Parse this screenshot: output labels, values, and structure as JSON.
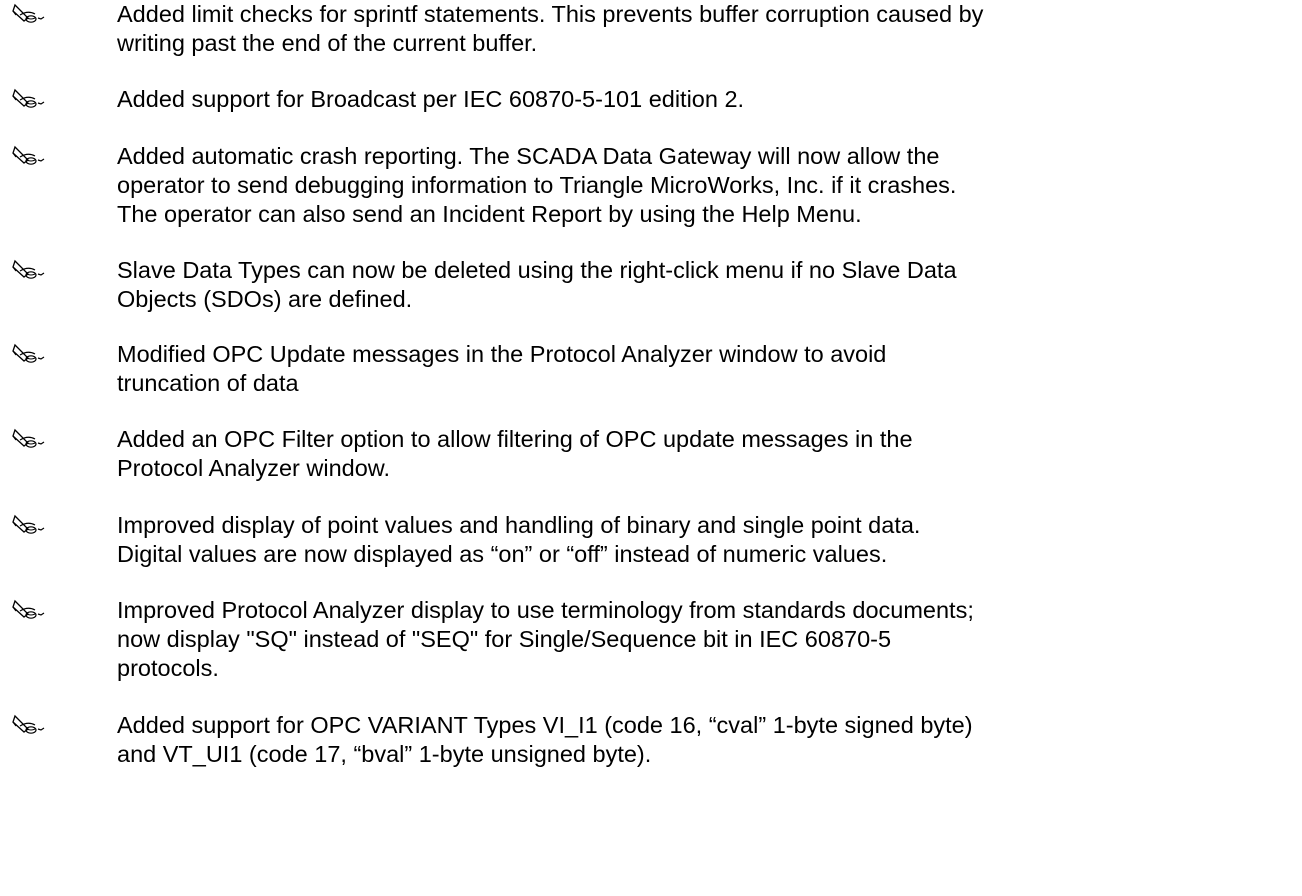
{
  "notes": [
    {
      "lines": [
        "Added limit checks for sprintf statements. This prevents buffer corruption caused by",
        "writing past the end of the current buffer."
      ]
    },
    {
      "lines": [
        "Added support for Broadcast per IEC 60870-5-101 edition 2."
      ]
    },
    {
      "lines": [
        "Added automatic crash reporting. The SCADA Data Gateway will now allow the",
        "operator to send debugging information to Triangle MicroWorks, Inc. if it crashes.",
        "The operator can also send an Incident Report by using the Help Menu."
      ]
    },
    {
      "lines": [
        "Slave Data Types can now be deleted using the right-click menu if no Slave Data",
        "Objects (SDOs) are defined."
      ]
    },
    {
      "lines": [
        "Modified OPC Update messages in the Protocol Analyzer window to avoid",
        "truncation of data"
      ]
    },
    {
      "lines": [
        "Added an OPC Filter option to allow filtering of OPC update messages in the",
        "Protocol Analyzer window."
      ]
    },
    {
      "lines": [
        "Improved display of point values and handling of binary and single point data.",
        "Digital values are now displayed as “on” or “off” instead of numeric values."
      ]
    },
    {
      "lines": [
        "Improved Protocol Analyzer display to use terminology from standards documents;",
        "now display \"SQ\" instead of \"SEQ\" for Single/Sequence bit in IEC 60870-5",
        "protocols."
      ]
    },
    {
      "lines": [
        "Added support for OPC VARIANT Types VI_I1 (code 16, “cval” 1-byte signed byte)",
        "and VT_UI1 (code 17, “bval” 1-byte unsigned byte)."
      ]
    }
  ]
}
